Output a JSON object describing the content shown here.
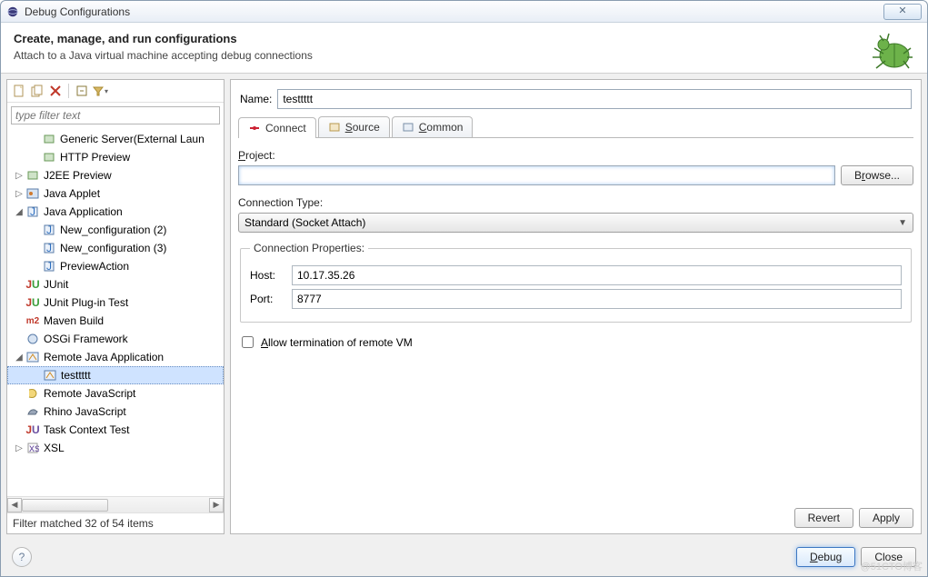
{
  "window": {
    "title": "Debug Configurations"
  },
  "header": {
    "title": "Create, manage, and run configurations",
    "subtitle": "Attach to a Java virtual machine accepting debug connections"
  },
  "left": {
    "filter_placeholder": "type filter text",
    "filter_status": "Filter matched 32 of 54 items",
    "items": [
      {
        "indent": 1,
        "twisty": "",
        "icon": "server-icon",
        "label": "Generic Server(External Laun"
      },
      {
        "indent": 1,
        "twisty": "",
        "icon": "server-icon",
        "label": "HTTP Preview"
      },
      {
        "indent": 0,
        "twisty": "▷",
        "icon": "server-icon",
        "label": "J2EE Preview"
      },
      {
        "indent": 0,
        "twisty": "▷",
        "icon": "applet-icon",
        "label": "Java Applet"
      },
      {
        "indent": 0,
        "twisty": "◢",
        "icon": "java-app-icon",
        "label": "Java Application"
      },
      {
        "indent": 1,
        "twisty": "",
        "icon": "java-app-icon",
        "label": "New_configuration (2)"
      },
      {
        "indent": 1,
        "twisty": "",
        "icon": "java-app-icon",
        "label": "New_configuration (3)"
      },
      {
        "indent": 1,
        "twisty": "",
        "icon": "java-app-icon",
        "label": "PreviewAction"
      },
      {
        "indent": 0,
        "twisty": "",
        "icon": "junit-icon",
        "label": "JUnit"
      },
      {
        "indent": 0,
        "twisty": "",
        "icon": "junit-plugin-icon",
        "label": "JUnit Plug-in Test"
      },
      {
        "indent": 0,
        "twisty": "",
        "icon": "maven-icon",
        "label": "Maven Build"
      },
      {
        "indent": 0,
        "twisty": "",
        "icon": "osgi-icon",
        "label": "OSGi Framework"
      },
      {
        "indent": 0,
        "twisty": "◢",
        "icon": "remote-java-icon",
        "label": "Remote Java Application"
      },
      {
        "indent": 1,
        "twisty": "",
        "icon": "remote-java-icon",
        "label": "testtttt",
        "selected": true
      },
      {
        "indent": 0,
        "twisty": "",
        "icon": "js-icon",
        "label": "Remote JavaScript"
      },
      {
        "indent": 0,
        "twisty": "",
        "icon": "rhino-icon",
        "label": "Rhino JavaScript"
      },
      {
        "indent": 0,
        "twisty": "",
        "icon": "task-icon",
        "label": "Task Context Test"
      },
      {
        "indent": 0,
        "twisty": "▷",
        "icon": "xsl-icon",
        "label": "XSL"
      }
    ]
  },
  "form": {
    "name_label": "Name:",
    "name_value": "testtttt",
    "tabs": [
      {
        "label": "Connect",
        "icon": "connect-icon",
        "active": true
      },
      {
        "label": "Source",
        "icon": "source-icon"
      },
      {
        "label": "Common",
        "icon": "common-icon"
      }
    ],
    "project_label": "Project:",
    "project_value": "",
    "browse_label": "Browse...",
    "conn_type_label": "Connection Type:",
    "conn_type_value": "Standard (Socket Attach)",
    "conn_props_label": "Connection Properties:",
    "host_label": "Host:",
    "host_value": "10.17.35.26",
    "port_label": "Port:",
    "port_value": "8777",
    "allow_terminate": "Allow termination of remote VM",
    "revert": "Revert",
    "apply": "Apply"
  },
  "bottom": {
    "debug": "Debug",
    "close": "Close"
  },
  "watermark": "@51CTO博客"
}
